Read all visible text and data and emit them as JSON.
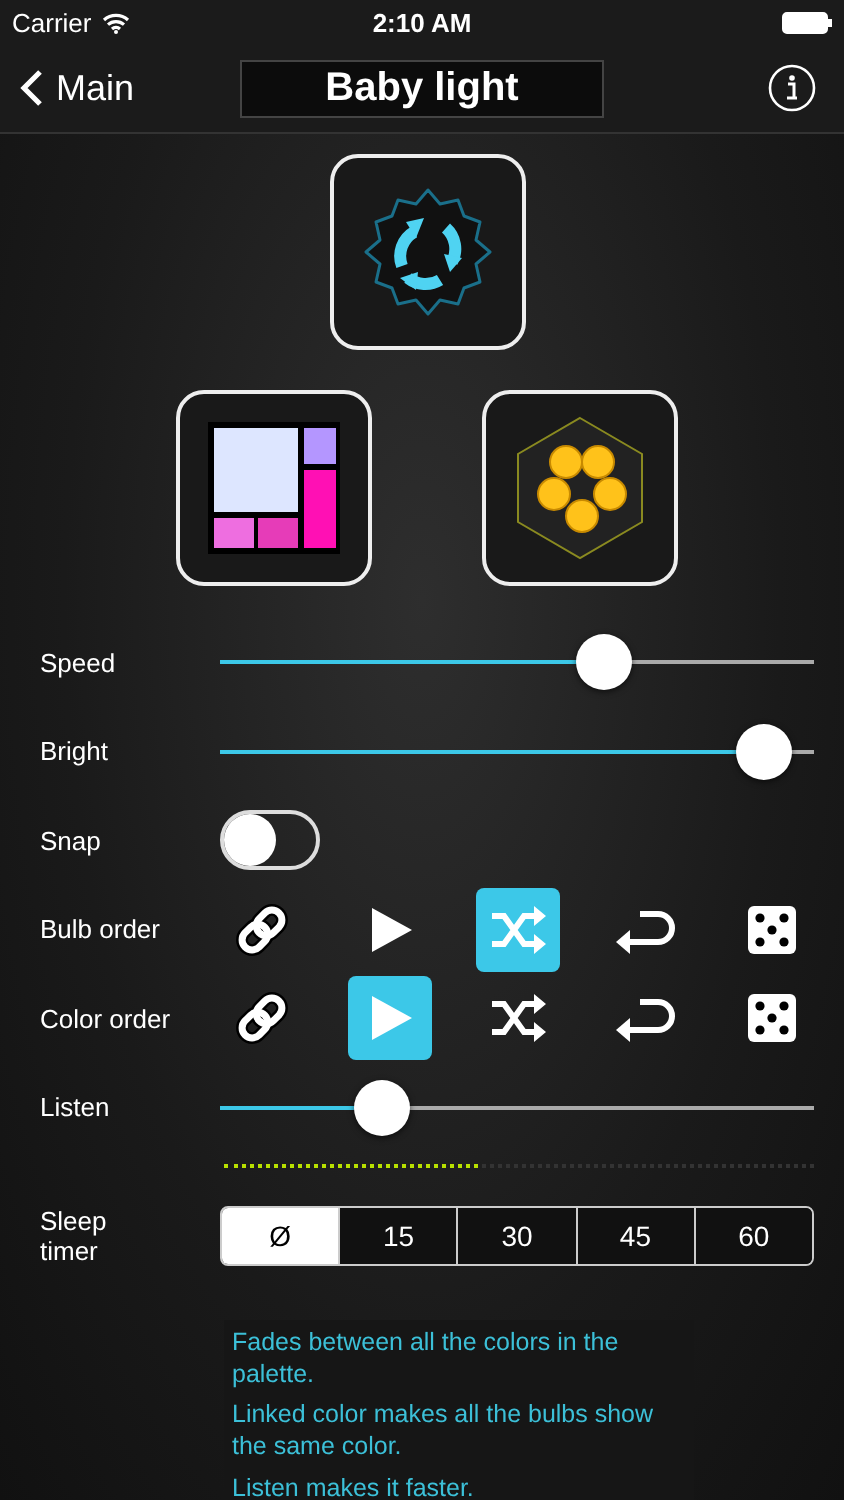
{
  "status_bar": {
    "carrier": "Carrier",
    "time": "2:10 AM"
  },
  "nav": {
    "back": "Main",
    "title": "Baby light"
  },
  "modes": [
    {
      "kind": "gear"
    },
    {
      "kind": "tiles"
    },
    {
      "kind": "hexagon"
    }
  ],
  "rows": [
    {
      "kind": "slider",
      "label": "Speed",
      "level": 0.66
    },
    {
      "kind": "slider",
      "label": "Bright",
      "level": 0.96
    },
    {
      "kind": "toggle",
      "label": "Snap",
      "on": false
    },
    {
      "kind": "choice",
      "label": "Bulb order",
      "options": [
        {
          "selected": false
        },
        {
          "selected": false
        },
        {
          "selected": true
        },
        {
          "selected": false
        },
        {
          "selected": false
        }
      ]
    },
    {
      "kind": "choice",
      "label": "Color order",
      "options": [
        {
          "selected": false
        },
        {
          "selected": true
        },
        {
          "selected": false
        },
        {
          "selected": false
        },
        {
          "selected": false
        }
      ]
    },
    {
      "kind": "slider",
      "label": "Listen",
      "level": 0.25
    },
    {
      "kind": "meter",
      "level": 0.43
    },
    {
      "kind": "segmented",
      "label": "Sleep timer",
      "segments": [
        {
          "label": "Ø",
          "selected": true
        },
        {
          "label": "15",
          "selected": false
        },
        {
          "label": "30",
          "selected": false
        },
        {
          "label": "45",
          "selected": false
        },
        {
          "label": "60",
          "selected": false
        }
      ]
    }
  ],
  "help": [
    "Fades between all the colors in the palette.",
    "Linked color makes all the bulbs show the same color.",
    "Listen makes it faster."
  ]
}
